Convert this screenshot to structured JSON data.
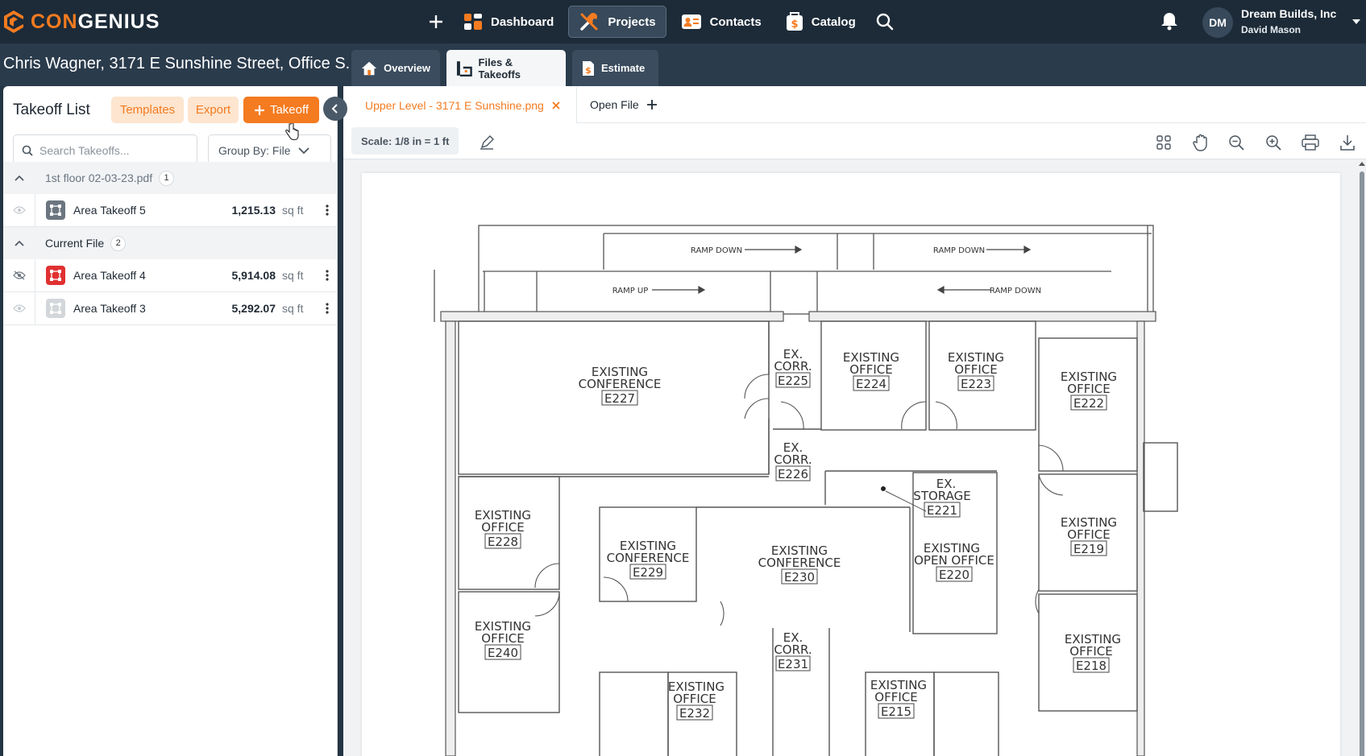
{
  "app": {
    "logo_prefix": "CON",
    "logo_suffix": "GENIUS",
    "nav": [
      {
        "label": "Dashboard"
      },
      {
        "label": "Projects"
      },
      {
        "label": "Contacts"
      },
      {
        "label": "Catalog"
      }
    ],
    "user": {
      "initials": "DM",
      "company": "Dream Builds, Inc",
      "name": "David Mason"
    }
  },
  "project": {
    "title": "Chris Wagner, 3171 E Sunshine Street, Office S...",
    "tabs": [
      {
        "label": "Overview"
      },
      {
        "label": "Files & Takeoffs"
      },
      {
        "label": "Estimate"
      }
    ]
  },
  "takeoff_panel": {
    "title": "Takeoff List",
    "templates_label": "Templates",
    "export_label": "Export",
    "add_label": "Takeoff",
    "search_placeholder": "Search Takeoffs...",
    "group_by_label": "Group By: File",
    "groups": [
      {
        "name": "1st floor 02-03-23.pdf",
        "count": "1",
        "items": [
          {
            "name": "Area Takeoff 5",
            "value": "1,215.13",
            "unit": "sq ft",
            "color": "#6b7580"
          }
        ]
      },
      {
        "name": "Current File",
        "count": "2",
        "items": [
          {
            "name": "Area Takeoff 4",
            "value": "5,914.08",
            "unit": "sq ft",
            "color": "#e03131"
          },
          {
            "name": "Area Takeoff 3",
            "value": "5,292.07",
            "unit": "sq ft",
            "color": "#b8bec4"
          }
        ]
      }
    ]
  },
  "viewer": {
    "active_file": "Upper Level - 3171 E Sunshine.png",
    "open_file_label": "Open File",
    "scale_label": "Scale: 1/8 in = 1 ft"
  },
  "plan": {
    "ramps": [
      "RAMP DOWN",
      "RAMP DOWN",
      "RAMP UP",
      "RAMP DOWN"
    ],
    "rooms": [
      {
        "l1": "EXISTING",
        "l2": "CONFERENCE",
        "id": "E227"
      },
      {
        "l1": "EX.",
        "l2": "CORR.",
        "id": "E225"
      },
      {
        "l1": "EXISTING",
        "l2": "OFFICE",
        "id": "E224"
      },
      {
        "l1": "EXISTING",
        "l2": "OFFICE",
        "id": "E223"
      },
      {
        "l1": "EXISTING",
        "l2": "OFFICE",
        "id": "E222"
      },
      {
        "l1": "EX.",
        "l2": "CORR.",
        "id": "E226"
      },
      {
        "l1": "EX.",
        "l2": "STORAGE",
        "id": "E221"
      },
      {
        "l1": "EXISTING",
        "l2": "OFFICE",
        "id": "E228"
      },
      {
        "l1": "EXISTING",
        "l2": "CONFERENCE",
        "id": "E229"
      },
      {
        "l1": "EXISTING",
        "l2": "CONFERENCE",
        "id": "E230"
      },
      {
        "l1": "EXISTING",
        "l2": "OPEN OFFICE",
        "id": "E220"
      },
      {
        "l1": "EXISTING",
        "l2": "OFFICE",
        "id": "E219"
      },
      {
        "l1": "EXISTING",
        "l2": "OFFICE",
        "id": "E240"
      },
      {
        "l1": "EX.",
        "l2": "CORR.",
        "id": "E231"
      },
      {
        "l1": "EXISTING",
        "l2": "OFFICE",
        "id": "E218"
      },
      {
        "l1": "EXISTING",
        "l2": "OFFICE",
        "id": "E232"
      },
      {
        "l1": "EXISTING",
        "l2": "OFFICE",
        "id": "E215"
      }
    ]
  }
}
